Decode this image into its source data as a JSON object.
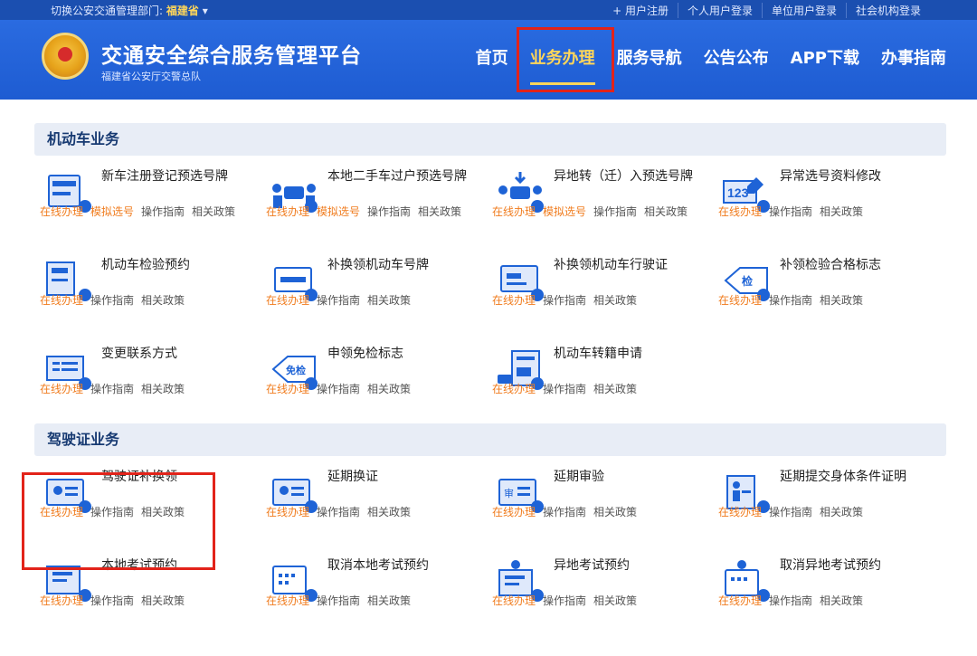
{
  "topbar": {
    "dept_label": "切换公安交通管理部门:",
    "dept_value": "福建省",
    "links": [
      "+ 用户注册",
      "个人用户登录",
      "单位用户登录",
      "社会机构登录"
    ]
  },
  "header": {
    "title": "交通安全综合服务管理平台",
    "subtitle": "福建省公安厅交警总队",
    "nav": [
      "首页",
      "业务办理",
      "服务导航",
      "公告公布",
      "APP下载",
      "办事指南"
    ],
    "active_nav": "业务办理"
  },
  "sections": [
    {
      "title": "机动车业务",
      "items": [
        {
          "title": "新车注册登记预选号牌",
          "links": [
            "在线办理",
            "模拟选号",
            "操作指南",
            "相关政策"
          ],
          "icon": "plate-icon"
        },
        {
          "title": "本地二手车过户预选号牌",
          "links": [
            "在线办理",
            "模拟选号",
            "操作指南",
            "相关政策"
          ],
          "icon": "car-transfer-icon"
        },
        {
          "title": "异地转（迁）入预选号牌",
          "links": [
            "在线办理",
            "模拟选号",
            "操作指南",
            "相关政策"
          ],
          "icon": "car-download-icon"
        },
        {
          "title": "异常选号资料修改",
          "links": [
            "在线办理",
            "操作指南",
            "相关政策"
          ],
          "icon": "number-edit-icon"
        },
        {
          "title": "机动车检验预约",
          "links": [
            "在线办理",
            "操作指南",
            "相关政策"
          ],
          "icon": "inspection-book-icon"
        },
        {
          "title": "补换领机动车号牌",
          "links": [
            "在线办理",
            "操作指南",
            "相关政策"
          ],
          "icon": "plate-replace-icon"
        },
        {
          "title": "补换领机动车行驶证",
          "links": [
            "在线办理",
            "操作指南",
            "相关政策"
          ],
          "icon": "license-replace-icon"
        },
        {
          "title": "补领检验合格标志",
          "links": [
            "在线办理",
            "操作指南",
            "相关政策"
          ],
          "icon": "inspection-tag-icon"
        },
        {
          "title": "变更联系方式",
          "links": [
            "在线办理",
            "操作指南",
            "相关政策"
          ],
          "icon": "contact-change-icon"
        },
        {
          "title": "申领免检标志",
          "links": [
            "在线办理",
            "操作指南",
            "相关政策"
          ],
          "icon": "exempt-tag-icon"
        },
        {
          "title": "机动车转籍申请",
          "links": [
            "在线办理",
            "操作指南",
            "相关政策"
          ],
          "icon": "car-transfer-doc-icon"
        }
      ]
    },
    {
      "title": "驾驶证业务",
      "items": [
        {
          "title": "驾驶证补换领",
          "links": [
            "在线办理",
            "操作指南",
            "相关政策"
          ],
          "icon": "license-card-icon"
        },
        {
          "title": "延期换证",
          "links": [
            "在线办理",
            "操作指南",
            "相关政策"
          ],
          "icon": "license-renew-icon"
        },
        {
          "title": "延期审验",
          "links": [
            "在线办理",
            "操作指南",
            "相关政策"
          ],
          "icon": "review-delay-icon"
        },
        {
          "title": "延期提交身体条件证明",
          "links": [
            "在线办理",
            "操作指南",
            "相关政策"
          ],
          "icon": "health-cert-icon"
        },
        {
          "title": "本地考试预约",
          "links": [
            "在线办理",
            "操作指南",
            "相关政策"
          ],
          "icon": "exam-book-icon"
        },
        {
          "title": "取消本地考试预约",
          "links": [
            "在线办理",
            "操作指南",
            "相关政策"
          ],
          "icon": "exam-cancel-icon"
        },
        {
          "title": "异地考试预约",
          "links": [
            "在线办理",
            "操作指南",
            "相关政策"
          ],
          "icon": "remote-exam-icon"
        },
        {
          "title": "取消异地考试预约",
          "links": [
            "在线办理",
            "操作指南",
            "相关政策"
          ],
          "icon": "remote-exam-cancel-icon"
        }
      ]
    }
  ],
  "colors": {
    "primary": "#1e5cd2",
    "accent": "#ffd65a",
    "link_orange": "#f07c1e",
    "highlight_red": "#e2231a"
  }
}
